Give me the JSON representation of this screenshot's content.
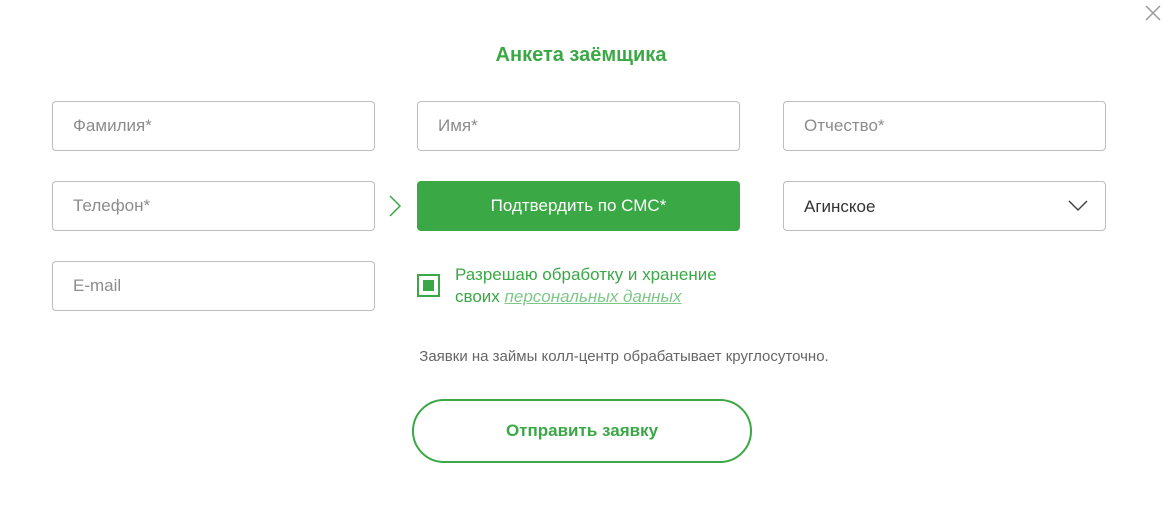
{
  "form": {
    "title": "Анкета заёмщика",
    "fields": {
      "last_name_placeholder": "Фамилия*",
      "first_name_placeholder": "Имя*",
      "middle_name_placeholder": "Отчество*",
      "phone_placeholder": "Телефон*",
      "email_placeholder": "E-mail"
    },
    "sms_button_label": "Подтвердить по СМС*",
    "city_select": {
      "selected": "Агинское"
    },
    "consent": {
      "checked": true,
      "text": "Разрешаю обработку и хранение своих ",
      "link_text": "персональных данных"
    },
    "info_text": "Заявки на займы колл-центр обрабатывает круглосуточно.",
    "submit_label": "Отправить заявку"
  },
  "colors": {
    "accent": "#3aa845",
    "link": "#7fc787",
    "border": "#bcbcbc",
    "info_text": "#666666"
  },
  "icons": {
    "close": "close-icon",
    "arrow": "chevron-right-icon",
    "select": "chevron-down-icon"
  }
}
